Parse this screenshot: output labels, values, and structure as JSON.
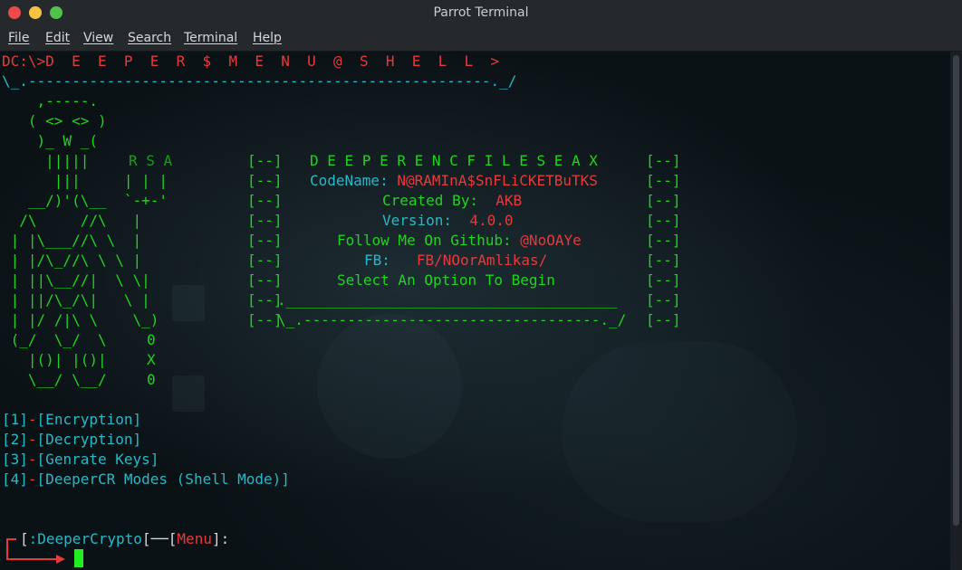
{
  "window": {
    "title": "Parrot Terminal",
    "menu": [
      "File",
      "Edit",
      "View",
      "Search",
      "Terminal",
      "Help"
    ]
  },
  "terminal": {
    "prompt_line": "DC:\\>D  E  E  P  E  R  $  M  E  N  U  @  S  H  E  L  L  >",
    "rule_line": "\\_.-----------------------------------------------------._/",
    "ascii_art": [
      "    ,-----.",
      "   ( <> <> )",
      "    )_ W _(",
      "     |||||   ",
      "      |||     | | |",
      "   __/)'(\\__  `-+-'",
      "  /\\     //\\   |",
      " | |\\___//\\ \\  |",
      " | |/\\_//\\ \\ \\ |",
      " | ||\\__//|  \\ \\|",
      " | ||/\\_/\\|   \\ |",
      " | |/ /|\\ \\    \\_)",
      " (_/  \\_/  \\    ",
      "   |()| |()|    ",
      "   \\__/ \\__/    "
    ],
    "side_letters": [
      "R S A",
      "0",
      "X",
      "0"
    ],
    "banner_title": "D E E P E R E N C F I L E S E A X",
    "banner_brackets": "[--]",
    "codename_label": "CodeName:",
    "codename_value": "N@RAMInA$SnFLiCKETBuTKS",
    "created_label": "Created By:",
    "created_value": "AKB",
    "version_label": "Version:",
    "version_value": "4.0.0",
    "github_label": "Follow Me On Github:",
    "github_value": "@NoOAYe",
    "fb_label": "FB:",
    "fb_value": "FB/NOorAmlikas/",
    "select_prompt": "Select An Option To Begin",
    "box_bottom_rule": ".______________________________________",
    "box_end_rule": "\\_.----------------------------------._/",
    "options": [
      {
        "num": "[1]",
        "label": "[Encryption]"
      },
      {
        "num": "[2]",
        "label": "[Decryption]"
      },
      {
        "num": "[3]",
        "label": "[Genrate Keys]"
      },
      {
        "num": "[4]",
        "label": "[DeeperCR Modes (Shell Mode)]"
      }
    ],
    "input_prompt": {
      "open": "[",
      "name": ":DeeperCrypto",
      "sep": "[",
      "menu": "Menu",
      "close": "]:"
    }
  },
  "colors": {
    "green": "#1fd41f",
    "red": "#e8393a",
    "cyan": "#27b8c6",
    "background": "#0b1216"
  }
}
